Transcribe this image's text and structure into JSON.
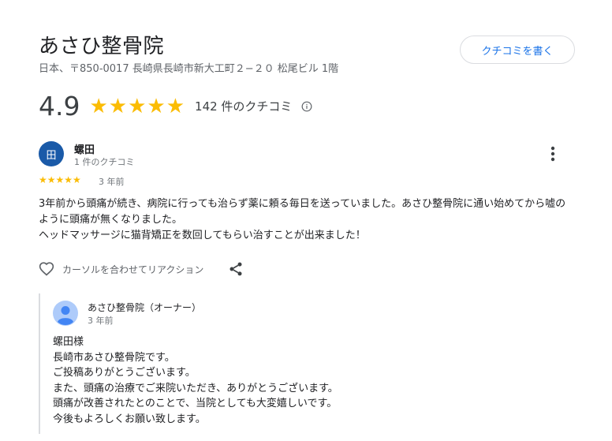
{
  "business": {
    "name": "あさひ整骨院",
    "address": "日本、〒850-0017 長崎県長崎市新大工町２−２０ 松尾ビル 1階",
    "write_review_label": "クチコミを書く",
    "rating": "4.9",
    "stars": "★★★★★",
    "review_count": "142 件のクチコミ"
  },
  "review": {
    "avatar_initial": "田",
    "reviewer_name": "螺田",
    "reviewer_meta": "1 件のクチコミ",
    "stars": "★★★★★",
    "time": "3 年前",
    "text": "3年前から頭痛が続き、病院に行っても治らず薬に頼る毎日を送っていました。あさひ整骨院に通い始めてから嘘のように頭痛が無くなりました。\nヘッドマッサージに猫背矯正を数回してもらい治すことが出来ました！",
    "reaction_label": "カーソルを合わせてリアクション"
  },
  "owner_reply": {
    "name": "あさひ整骨院（オーナー）",
    "time": "3 年前",
    "text": "螺田様\n長崎市あさひ整骨院です。\nご投稿ありがとうございます。\nまた、頭痛の治療でご来院いただき、ありがとうございます。\n頭痛が改善されたとのことで、当院としても大変嬉しいです。\n今後もよろしくお願い致します。"
  },
  "colors": {
    "accent": "#1a73e8",
    "star": "#fbbc04",
    "avatar": "#1a5aa8"
  }
}
